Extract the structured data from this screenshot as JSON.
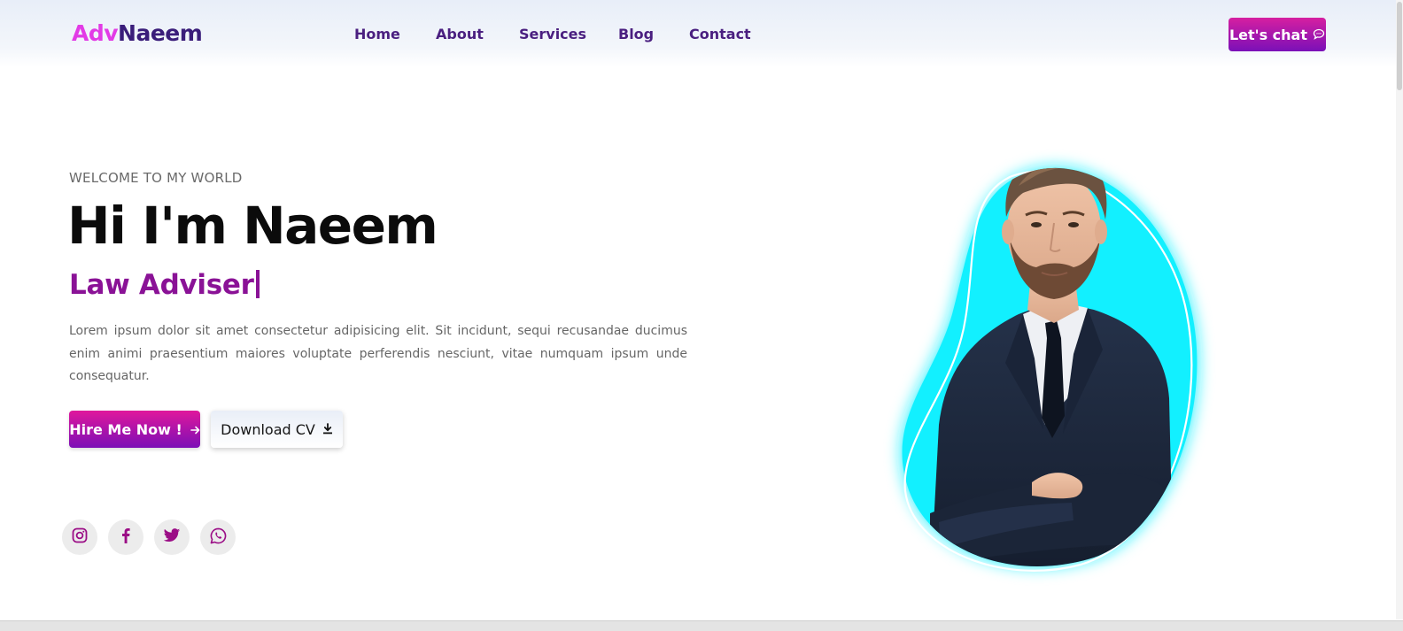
{
  "header": {
    "logo_part1": "Adv",
    "logo_part2": "Naeem",
    "nav": [
      "Home",
      "About",
      "Services",
      "Blog",
      "Contact"
    ],
    "chat_label": "Let's chat"
  },
  "hero": {
    "welcome": "WELCOME TO MY WORLD",
    "title": "Hi I'm Naeem",
    "role": "Law Adviser",
    "description": "Lorem ipsum dolor sit amet consectetur adipisicing elit. Sit incidunt, sequi recusandae ducimus enim animi praesentium maiores voluptate perferendis nesciunt, vitae numquam ipsum unde consequatur.",
    "hire_label": "Hire Me Now !",
    "cv_label": "Download CV"
  },
  "social": [
    "instagram-icon",
    "facebook-icon",
    "twitter-icon",
    "whatsapp-icon"
  ],
  "colors": {
    "accent_pink": "#e23be6",
    "accent_purple": "#7a10b8",
    "nav_text": "#4a1f80",
    "role_text": "#8a1296",
    "blob_cyan": "#12f0ff"
  }
}
